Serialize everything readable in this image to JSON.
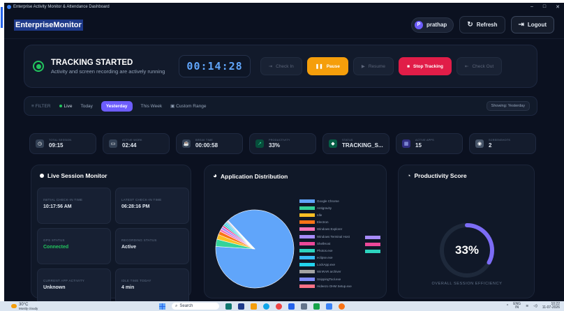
{
  "window": {
    "title": "Enterprise Activity Monitor & Attendance Dashboard",
    "controls": [
      "–",
      "□",
      "✕"
    ]
  },
  "header": {
    "brand": "EnterpriseMonitor",
    "user": {
      "initial": "P",
      "name": "prathap"
    },
    "refresh_label": "Refresh",
    "logout_label": "Logout"
  },
  "tracking": {
    "title": "TRACKING STARTED",
    "subtitle": "Activity and screen recording are actively running",
    "timer": "00:14:28",
    "buttons": {
      "check_in": "Check In",
      "pause": "Pause",
      "resume": "Resume",
      "stop": "Stop Tracking",
      "check_out": "Check Out"
    }
  },
  "filter": {
    "label": "FILTER",
    "options": [
      "Live",
      "Today",
      "Yesterday",
      "This Week",
      "Custom Range"
    ],
    "active": "Yesterday",
    "showing": "Showing: Yesterday"
  },
  "stats": [
    {
      "label": "TOTAL SESSION",
      "value": "09:15",
      "icon": "clock-icon",
      "color": "#334155"
    },
    {
      "label": "ACTIVE WORK",
      "value": "02:44",
      "icon": "monitor-icon",
      "color": "#334155"
    },
    {
      "label": "BREAK TIME",
      "value": "00:00:58",
      "icon": "coffee-icon",
      "color": "#334155"
    },
    {
      "label": "PRODUCTIVITY",
      "value": "33%",
      "icon": "trend-icon",
      "color": "#10b981"
    },
    {
      "label": "STATUS",
      "value": "TRACKING_S...",
      "icon": "shield-icon",
      "color": "#10b981"
    },
    {
      "label": "ACTIVE APPS",
      "value": "15",
      "icon": "grid-icon",
      "color": "#4f46e5"
    },
    {
      "label": "SCREENSHOTS",
      "value": "2",
      "icon": "camera-icon",
      "color": "#475569"
    }
  ],
  "live_monitor": {
    "title": "Live Session Monitor",
    "cells": [
      {
        "label": "INITIAL CHECK-IN TIME",
        "value": "10:17:56 AM"
      },
      {
        "label": "LATEST CHECK-IN TIME",
        "value": "06:28:16 PM"
      },
      {
        "label": "GPS STATUS",
        "value": "Connected",
        "status": "green"
      },
      {
        "label": "RECORDING STATUS",
        "value": "Active"
      },
      {
        "label": "CURRENT APP ACTIVITY",
        "value": "Unknown"
      },
      {
        "label": "IDLE TIME TODAY",
        "value": "4 min"
      }
    ]
  },
  "app_distribution": {
    "title": "Application Distribution",
    "legend_extra_colors": [
      "#a78bfa",
      "#ec4899",
      "#2dd4bf"
    ]
  },
  "chart_data": {
    "type": "pie",
    "title": "Application Distribution",
    "categories": [
      "Google Chrome",
      "Antigravity",
      "Idle",
      "Electron",
      "Windows Explorer",
      "Windows Terminal Host",
      "ShellHost",
      "Photos.exe",
      "eclipse.exe",
      "LockApp.exe",
      "WinRAR archiver",
      "SnippingTool.exe",
      "Hideezo OHM Setup.exe"
    ],
    "values": [
      88,
      3,
      2,
      1.5,
      1,
      1,
      0.8,
      0.7,
      0.6,
      0.5,
      0.4,
      0.3,
      0.2
    ],
    "colors": [
      "#60a5fa",
      "#34d399",
      "#fbbf24",
      "#f97316",
      "#f472b6",
      "#a78bfa",
      "#ec4899",
      "#2dd4bf",
      "#38bdf8",
      "#22d3ee",
      "#a3a3a3",
      "#818cf8",
      "#fb7185"
    ]
  },
  "productivity": {
    "title": "Productivity Score",
    "score_text": "33%",
    "score": 0.33,
    "footer": "OVERALL SESSION EFFICIENCY"
  },
  "taskbar": {
    "temperature": "30°C",
    "weather": "Mostly cloudy",
    "search": "Search",
    "lang": "ENG",
    "region": "IN",
    "time": "10:22",
    "date": "11-07-2026"
  }
}
